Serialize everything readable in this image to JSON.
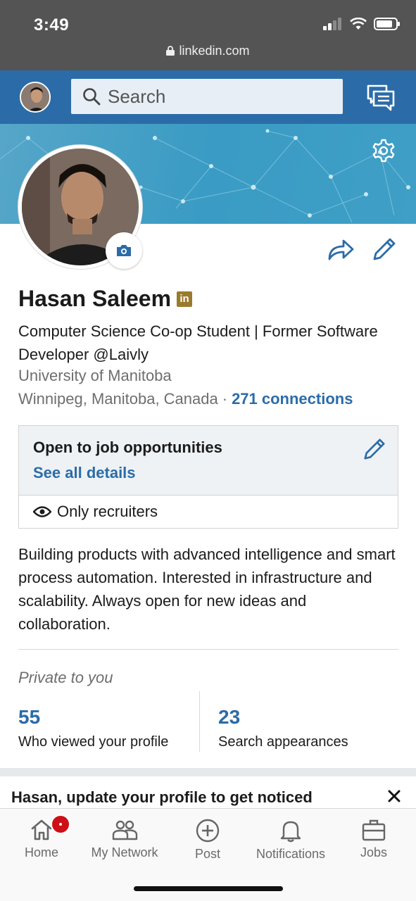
{
  "status_bar": {
    "time": "3:49",
    "url": "linkedin.com"
  },
  "header": {
    "search_placeholder": "Search"
  },
  "profile": {
    "name": "Hasan Saleem",
    "badge": "in",
    "headline": "Computer Science Co-op Student | Former Software Developer @Laivly",
    "school": "University of Manitoba",
    "location": "Winnipeg, Manitoba, Canada",
    "separator": "·",
    "connections": "271 connections"
  },
  "open_to_work": {
    "title": "Open to job opportunities",
    "link": "See all details",
    "visibility": "Only recruiters"
  },
  "summary": "Building products with advanced intelligence and smart process automation. Interested in infrastructure and scalability. Always open for new ideas and collaboration.",
  "private": {
    "label": "Private to you",
    "stats": [
      {
        "value": "55",
        "label": "Who viewed your profile"
      },
      {
        "value": "23",
        "label": "Search appearances"
      }
    ]
  },
  "promo": {
    "text": "Hasan, update your profile to get noticed"
  },
  "tabs": [
    {
      "label": "Home",
      "icon": "home-icon"
    },
    {
      "label": "My Network",
      "icon": "network-icon"
    },
    {
      "label": "Post",
      "icon": "post-icon"
    },
    {
      "label": "Notifications",
      "icon": "bell-icon"
    },
    {
      "label": "Jobs",
      "icon": "briefcase-icon"
    }
  ],
  "colors": {
    "brand": "#2b6ca8",
    "header": "#2b6ca8",
    "badge": "#cc1016",
    "premium": "#9a7a2c"
  }
}
